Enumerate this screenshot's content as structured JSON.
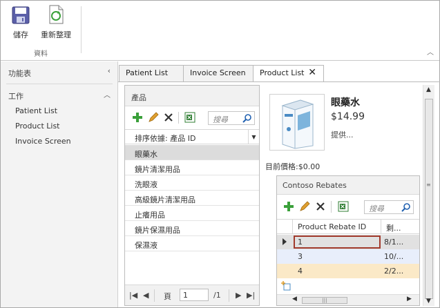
{
  "ribbon": {
    "save_label": "儲存",
    "refresh_label": "重新整理",
    "group_label": "資料"
  },
  "nav": {
    "header": "功能表",
    "group": "工作",
    "items": [
      "Patient List",
      "Product List",
      "Invoice Screen"
    ]
  },
  "tabs": [
    {
      "label": "Patient List"
    },
    {
      "label": "Invoice Screen"
    },
    {
      "label": "Product List"
    }
  ],
  "products": {
    "title": "產品",
    "search_placeholder": "搜尋",
    "sort_label": "排序依據: 產品 ID",
    "rows": [
      "眼藥水",
      "鏡片清潔用品",
      "洗眼液",
      "高級鏡片清潔用品",
      "止癢用品",
      "鏡片保濕用品",
      "保濕液"
    ],
    "pager": {
      "page_label": "頁",
      "page_value": "1",
      "total": "/1"
    }
  },
  "details": {
    "name": "眼藥水",
    "price": "$14.99",
    "desc": "提供...",
    "current_price": "目前價格:$0.00"
  },
  "rebates": {
    "title": "Contoso Rebates",
    "search_placeholder": "搜尋",
    "columns": [
      "Product Rebate ID",
      "剩..."
    ],
    "rows": [
      {
        "id": "1",
        "c2": "8/1..."
      },
      {
        "id": "3",
        "c2": "10/..."
      },
      {
        "id": "4",
        "c2": "2/2..."
      }
    ]
  },
  "colors": {
    "selection_border": "#a13a2c",
    "row_highlight": "#fbe9c7",
    "row_alt": "#e8eefb"
  }
}
